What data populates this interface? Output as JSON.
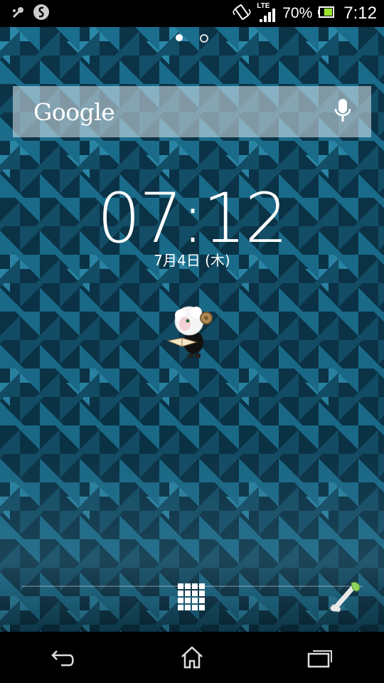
{
  "status_bar": {
    "network_type": "LTE",
    "battery_percent": "70%",
    "time": "7:12",
    "battery_level": 0.7
  },
  "home": {
    "page_count": 2,
    "active_page": 1,
    "search": {
      "logo_text": "Google"
    },
    "clock": {
      "time": "07:12",
      "date": "7月4日 (木)"
    }
  },
  "icons": {
    "notification_1": "usb-debug-icon",
    "notification_2": "sync-icon",
    "vibrate": "vibrate-icon",
    "signal": "signal-icon",
    "battery": "battery-icon",
    "mic": "mic-icon",
    "apps": "app-drawer-icon",
    "phone": "phone-icon",
    "back": "back-icon",
    "home": "home-icon",
    "recents": "recents-icon",
    "widget": "sheep-widget"
  }
}
